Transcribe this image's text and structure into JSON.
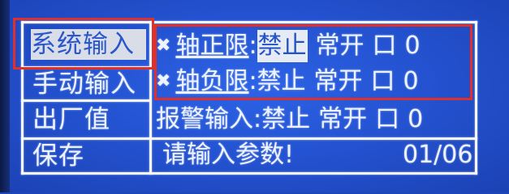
{
  "menu": {
    "items": [
      {
        "label": "系统输入",
        "selected": true
      },
      {
        "label": "手动输入",
        "selected": false
      },
      {
        "label": "出厂值",
        "selected": false
      },
      {
        "label": "保存",
        "selected": false
      }
    ]
  },
  "params": {
    "rows": [
      {
        "icon": "x-mark-icon",
        "icon_glyph": "✖",
        "name": "轴正限",
        "sep": ":",
        "value": "禁止",
        "mode": "常开",
        "port": "口",
        "index": "0"
      },
      {
        "icon": "x-mark-icon",
        "icon_glyph": "✖",
        "name": "轴负限",
        "sep": ":",
        "value": "禁止",
        "mode": "常开",
        "port": "口",
        "index": "0"
      },
      {
        "name": "报警输入",
        "sep": ":",
        "value": "禁止",
        "mode": "常开",
        "port": "口",
        "index": "0"
      }
    ]
  },
  "status": {
    "prompt": "请输入参数!",
    "page": "01/06"
  },
  "colors": {
    "lcd_background": "#2453d2",
    "foreground": "#eef4ff",
    "highlight": "#e6ebf4",
    "annotation": "#e0302b"
  }
}
